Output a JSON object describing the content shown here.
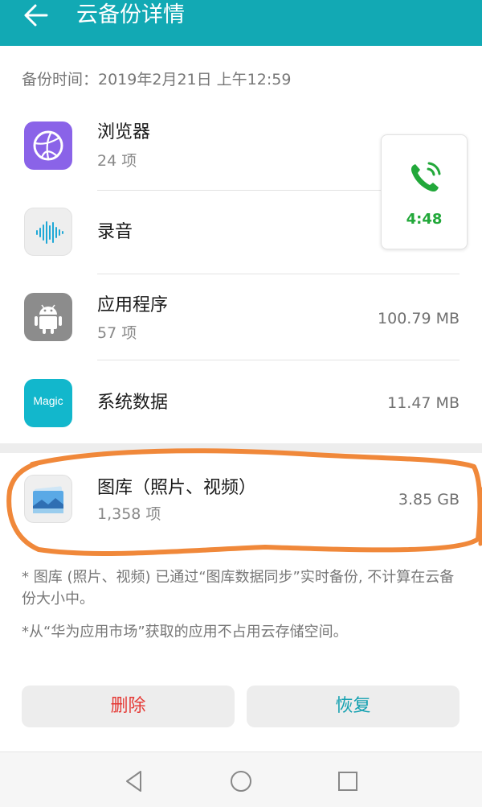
{
  "header": {
    "title": "云备份详情"
  },
  "backup_time": "备份时间：2019年2月21日 上午12:59",
  "items": [
    {
      "name": "浏览器",
      "sub": "24 项",
      "size": ""
    },
    {
      "name": "录音",
      "sub": "",
      "size": ""
    },
    {
      "name": "应用程序",
      "sub": "57 项",
      "size": "100.79 MB"
    },
    {
      "name": "系统数据",
      "sub": "",
      "size": "11.47 MB",
      "icon_text": "Magic"
    }
  ],
  "gallery": {
    "name": "图库（照片、视频）",
    "sub": "1,358 项",
    "size": "3.85 GB"
  },
  "notes": {
    "note1": "* 图库 (照片、视频) 已通过“图库数据同步”实时备份, 不计算在云备份大小中。",
    "note2": "*从“华为应用市场”获取的应用不占用云存储空间。"
  },
  "buttons": {
    "delete": "删除",
    "restore": "恢复"
  },
  "call_bubble": {
    "time": "4:48"
  },
  "colors": {
    "header": "#12a9b4",
    "delete": "#e53935",
    "restore": "#12a9b4",
    "call_green": "#22a83a",
    "highlight": "#f0883a"
  },
  "icons": [
    "back-arrow-icon",
    "browser-icon",
    "recorder-icon",
    "android-icon",
    "magic-icon",
    "gallery-icon",
    "phone-call-icon",
    "nav-back-icon",
    "nav-home-icon",
    "nav-recent-icon"
  ]
}
